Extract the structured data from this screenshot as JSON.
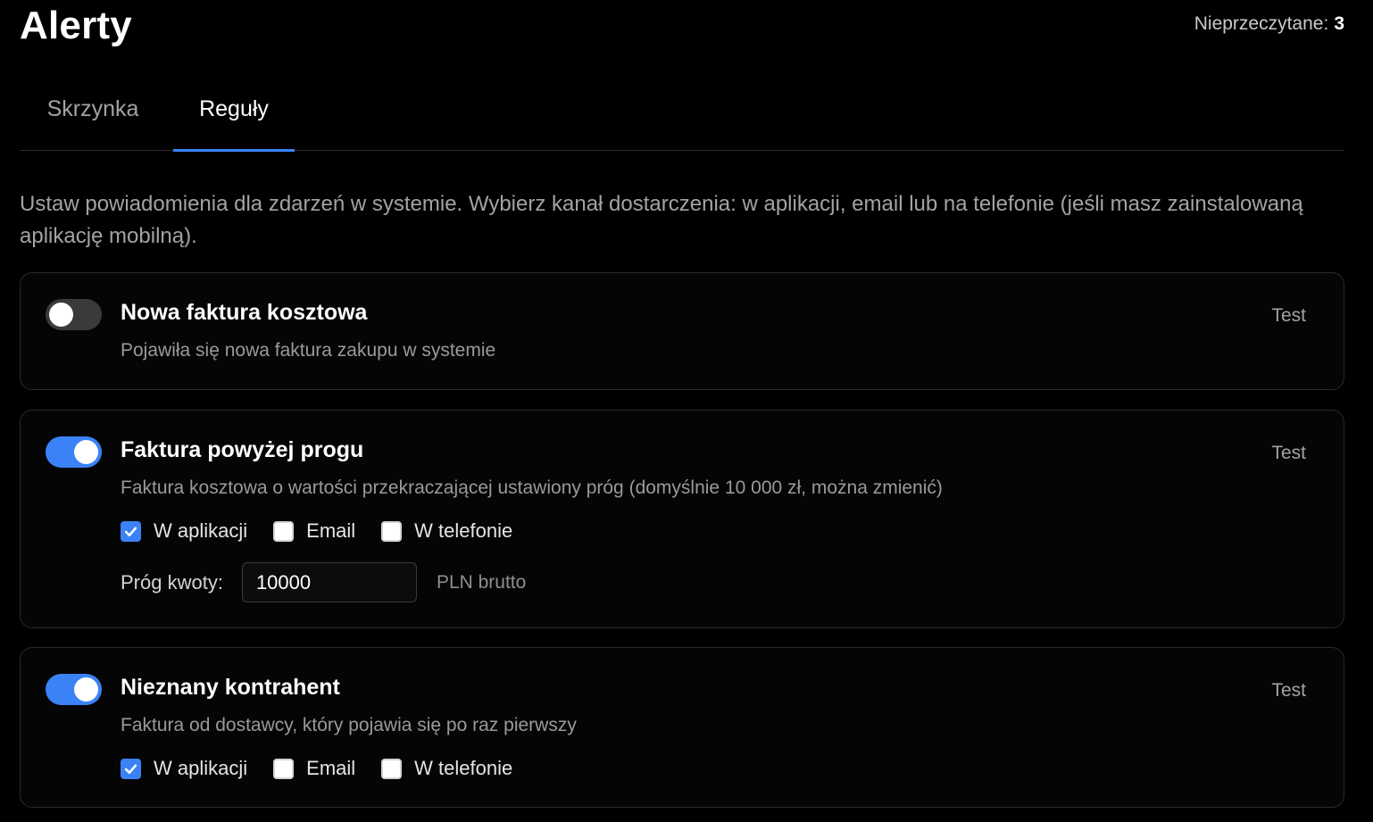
{
  "header": {
    "title": "Alerty",
    "unread_label": "Nieprzeczytane:",
    "unread_count": "3"
  },
  "tabs": [
    {
      "label": "Skrzynka",
      "active": false
    },
    {
      "label": "Reguły",
      "active": true
    }
  ],
  "intro": "Ustaw powiadomienia dla zdarzeń w systemie. Wybierz kanał dostarczenia: w aplikacji, email lub na telefonie (jeśli masz zainstalowaną aplikację mobilną).",
  "colors": {
    "accent": "#3b82f6",
    "background": "#000000"
  },
  "rules": [
    {
      "title": "Nowa faktura kosztowa",
      "description": "Pojawiła się nowa faktura zakupu w systemie",
      "enabled": false,
      "test_label": "Test"
    },
    {
      "title": "Faktura powyżej progu",
      "description": "Faktura kosztowa o wartości przekraczającej ustawiony próg (domyślnie 10 000 zł, można zmienić)",
      "enabled": true,
      "test_label": "Test",
      "channels": [
        {
          "label": "W aplikacji",
          "checked": true
        },
        {
          "label": "Email",
          "checked": false
        },
        {
          "label": "W telefonie",
          "checked": false
        }
      ],
      "threshold": {
        "label": "Próg kwoty:",
        "value": "10000",
        "unit": "PLN brutto"
      }
    },
    {
      "title": "Nieznany kontrahent",
      "description": "Faktura od dostawcy, który pojawia się po raz pierwszy",
      "enabled": true,
      "test_label": "Test",
      "channels": [
        {
          "label": "W aplikacji",
          "checked": true
        },
        {
          "label": "Email",
          "checked": false
        },
        {
          "label": "W telefonie",
          "checked": false
        }
      ]
    }
  ]
}
